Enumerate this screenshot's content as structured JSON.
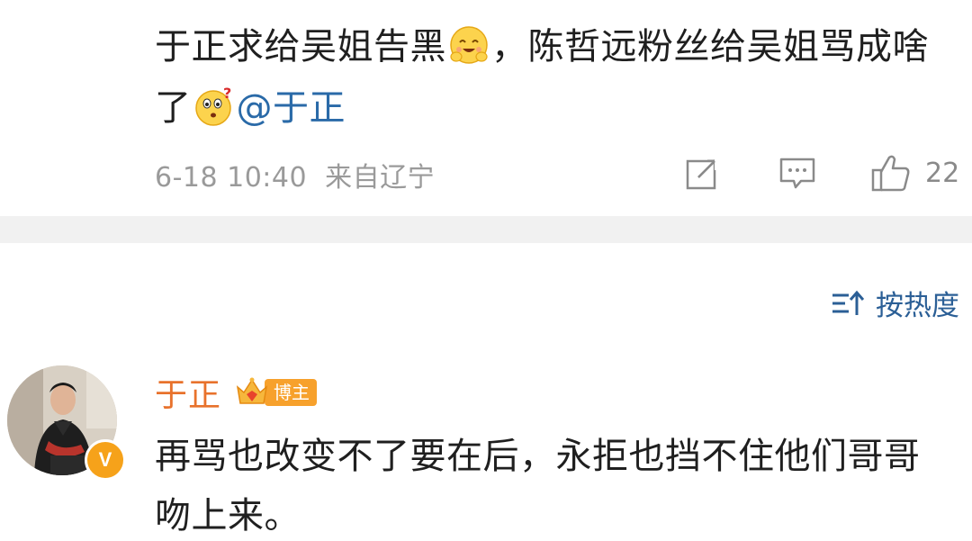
{
  "post": {
    "text_part1": "于正求给吴姐告黑",
    "text_part2": "，陈哲远粉丝给吴姐骂成啥了",
    "mention": "@于正",
    "emoji_1": "hug-emoji",
    "emoji_2": "puzzled-emoji",
    "timestamp": "6-18 10:40",
    "location": "来自辽宁",
    "like_count": "22",
    "icons": {
      "share": "share-icon",
      "comment": "comment-icon",
      "like": "thumbs-up-icon"
    }
  },
  "comments_header": {
    "sort_label": "按热度",
    "sort_icon": "sort-icon"
  },
  "comment": {
    "author": "于正",
    "badge": "博主",
    "verified": "V",
    "text": "再骂也改变不了要在后，永拒也挡不住他们哥哥吻上来。"
  },
  "colors": {
    "name": "#e8722c",
    "link": "#2a6aa8",
    "meta": "#9a9a9a",
    "badge": "#f7a12c",
    "divider": "#f1f1f1"
  }
}
